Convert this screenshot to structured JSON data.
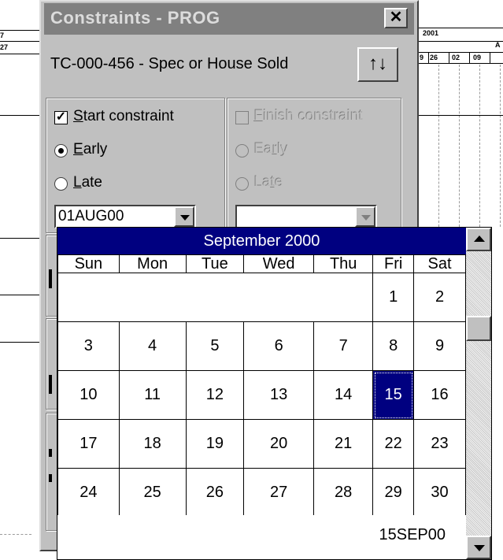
{
  "gantt": {
    "left_label_top": "7",
    "left_label_bottom": "27",
    "year": "2001",
    "month_letter": "A",
    "weeks": [
      "9",
      "26",
      "02",
      "09"
    ]
  },
  "dialog": {
    "title": "Constraints - PROG",
    "close_glyph": "✕",
    "activity": "TC-000-456 - Spec or House Sold",
    "updown_glyph": "↑↓",
    "start": {
      "checkbox_mark": "✓",
      "label_prefix": "S",
      "label_rest": "tart constraint",
      "early_u": "E",
      "early_rest": "arly",
      "late_u": "L",
      "late_rest": "ate",
      "date": "01AUG00"
    },
    "finish": {
      "label_prefix": "F",
      "label_rest": "inish constraint",
      "early_pre": "Ea",
      "early_u": "r",
      "early_rest": "ly",
      "late_pre": "La",
      "late_u": "t",
      "late_rest": "e",
      "date": ""
    }
  },
  "calendar": {
    "month": "September 2000",
    "days": [
      "Sun",
      "Mon",
      "Tue",
      "Wed",
      "Thu",
      "Fri",
      "Sat"
    ],
    "weeks": [
      [
        "",
        "",
        "",
        "",
        "",
        "1",
        "2"
      ],
      [
        "3",
        "4",
        "5",
        "6",
        "7",
        "8",
        "9"
      ],
      [
        "10",
        "11",
        "12",
        "13",
        "14",
        "15",
        "16"
      ],
      [
        "17",
        "18",
        "19",
        "20",
        "21",
        "22",
        "23"
      ],
      [
        "24",
        "25",
        "26",
        "27",
        "28",
        "29",
        "30"
      ]
    ],
    "selected": "15",
    "footer": "15SEP00",
    "colors": {
      "header_bg": "#000080",
      "selected_bg": "#000080"
    }
  }
}
